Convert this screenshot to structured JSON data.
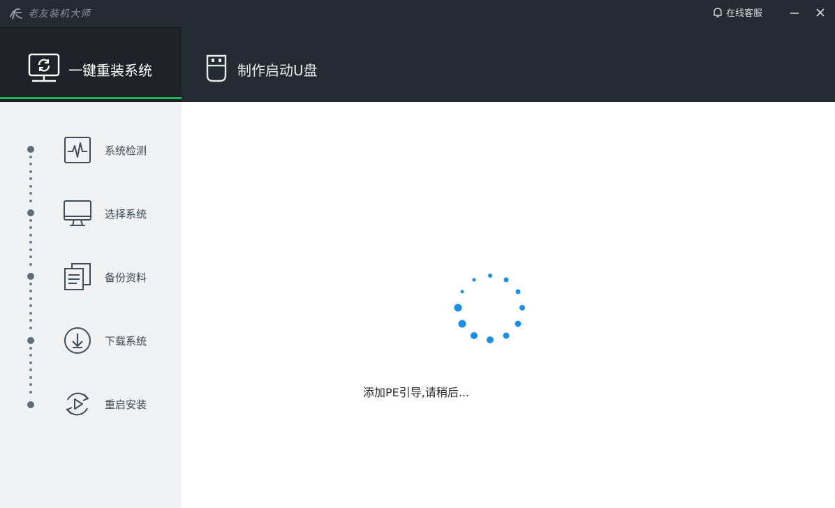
{
  "app": {
    "title": "老友装机大师"
  },
  "titlebar": {
    "service_label": "在线客服",
    "minimize_icon": "minimize-icon",
    "close_icon": "close-icon"
  },
  "tabs": [
    {
      "label": "一键重装系统",
      "icon": "monitor-refresh-icon",
      "active": true
    },
    {
      "label": "制作启动U盘",
      "icon": "usb-drive-icon",
      "active": false
    }
  ],
  "steps": [
    {
      "label": "系统检测",
      "icon": "pulse-monitor-icon"
    },
    {
      "label": "选择系统",
      "icon": "desktop-icon"
    },
    {
      "label": "备份资料",
      "icon": "documents-icon"
    },
    {
      "label": "下载系统",
      "icon": "download-icon"
    },
    {
      "label": "重启安装",
      "icon": "restart-icon"
    }
  ],
  "main": {
    "status_text": "添加PE引导,请稍后..."
  },
  "colors": {
    "header_bg": "#262b33",
    "active_tab_bg": "#1e2228",
    "accent_green": "#19b955",
    "spinner_blue": "#1a8fe8",
    "sidebar_bg": "#f0f1f3"
  }
}
